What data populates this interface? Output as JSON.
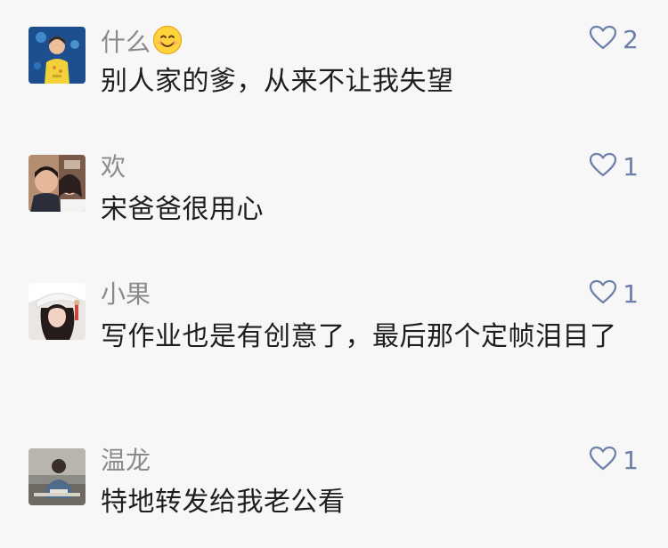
{
  "comments": [
    {
      "nickname": "什么",
      "nickname_emoji": "smiling-face-emoji",
      "text": "别人家的爹，从来不让我失望",
      "likes": "2",
      "avatar": "child-in-yellow-photo"
    },
    {
      "nickname": "欢",
      "text": "宋爸爸很用心",
      "likes": "1",
      "avatar": "couple-selfie-photo"
    },
    {
      "nickname": "小果",
      "text": "写作业也是有创意了，最后那个定帧泪目了",
      "likes": "1",
      "avatar": "girl-white-hat-photo"
    },
    {
      "nickname": "温龙",
      "text": "特地转发给我老公看",
      "likes": "1",
      "avatar": "person-at-desk-photo"
    }
  ],
  "colors": {
    "background": "#f7f7f7",
    "nickname": "#8a8a8a",
    "text": "#1e1e1e",
    "like": "#6b7fa8"
  }
}
